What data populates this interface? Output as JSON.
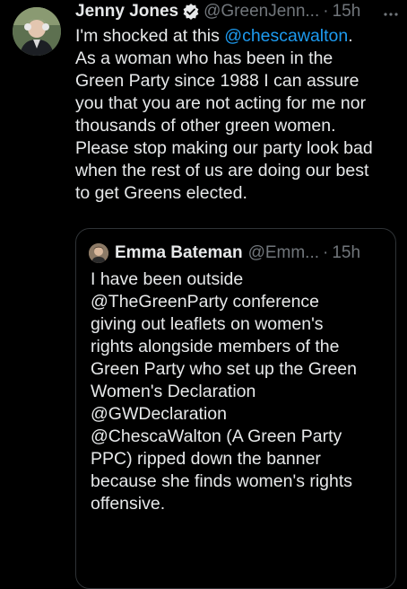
{
  "tweet": {
    "author_name": "Jenny Jones",
    "author_handle": "@GreenJenn...",
    "separator": "·",
    "timestamp": "15h",
    "verified_icon": "verified-badge-icon",
    "more_icon": "more-options-icon",
    "text_lines": [
      {
        "before": "I'm shocked at this ",
        "mention": "@chescawalton",
        "after": "."
      },
      "As a woman who has been in the",
      "Green Party since 1988 I can assure",
      "you that you are not acting for me nor",
      "thousands of other green women.",
      "Please stop making our party look bad",
      "when the rest of us are doing our best",
      "to get Greens elected."
    ]
  },
  "quoted_tweet": {
    "author_name": "Emma Bateman",
    "author_handle": "@Emm...",
    "separator": "·",
    "timestamp": "15h",
    "text_lines": [
      "I have been outside",
      "@TheGreenParty conference",
      "giving out leaflets on women's",
      "rights alongside members of the",
      "Green Party who set up the Green",
      "Women's Declaration",
      "@GWDeclaration",
      "@ChescaWalton (A Green Party",
      "PPC) ripped down the banner",
      "because she finds women's rights",
      "offensive."
    ]
  },
  "colors": {
    "background": "#000000",
    "text": "#e7e9ea",
    "secondary": "#71767b",
    "accent": "#1d9bf0",
    "border": "#2f3336"
  }
}
